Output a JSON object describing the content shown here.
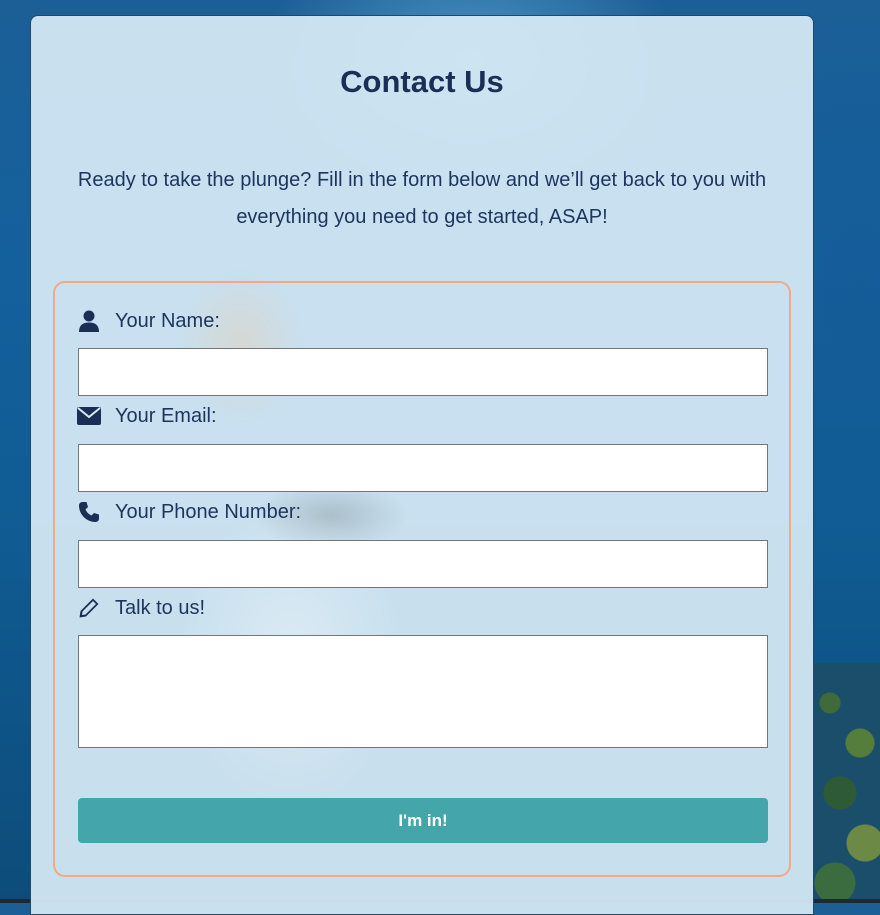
{
  "page": {
    "title": "Contact Us",
    "intro": "Ready to take the plunge? Fill in the form below and we’ll get back to you with everything you need to get started, ASAP!"
  },
  "form": {
    "fields": [
      {
        "label": "Your Name:",
        "icon": "user-icon",
        "value": ""
      },
      {
        "label": "Your Email:",
        "icon": "envelope-icon",
        "value": ""
      },
      {
        "label": "Your Phone Number:",
        "icon": "phone-icon",
        "value": ""
      },
      {
        "label": "Talk to us!",
        "icon": "pencil-icon",
        "value": ""
      }
    ],
    "submit_label": "I'm in!"
  },
  "colors": {
    "heading": "#1b2f56",
    "form_border": "#f2aa86",
    "button": "#44a6ab",
    "card_background": "#d8ecf6"
  }
}
